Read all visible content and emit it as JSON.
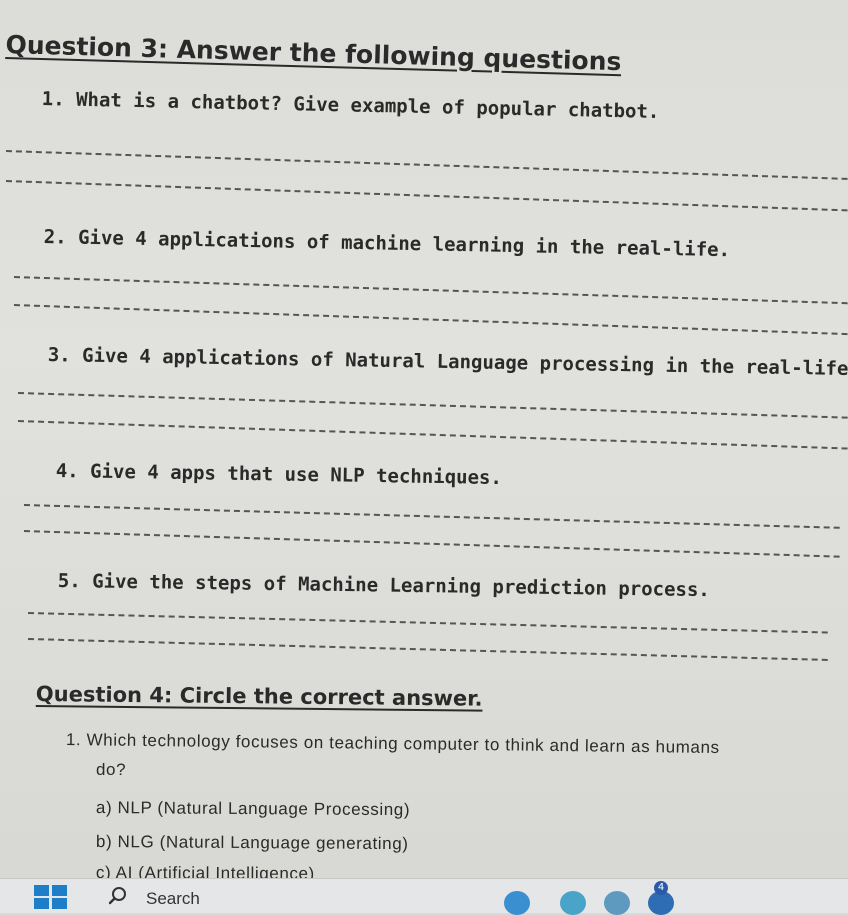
{
  "q3": {
    "title": "Question 3: Answer the following questions",
    "items": [
      "1. What is a chatbot? Give example of popular chatbot.",
      "2. Give 4 applications of machine learning in the real-life.",
      "3. Give 4 applications of Natural Language processing in the real-life.",
      "4. Give 4 apps that use NLP techniques.",
      "5. Give the steps of Machine Learning prediction process."
    ]
  },
  "q4": {
    "title": "Question 4: Circle the correct answer.",
    "question_line1": "1. Which technology focuses on teaching computer to think and learn as humans",
    "question_line2": "do?",
    "options": [
      "a) NLP (Natural Language Processing)",
      "b) NLG (Natural Language generating)",
      "c) AI (Artificial Intelligence)"
    ]
  },
  "taskbar": {
    "search_label": "Search",
    "notification_count": "4",
    "icons": [
      "windows-start-icon",
      "search-icon"
    ]
  },
  "colors": {
    "paper": "#dcdcd8",
    "ink": "#2a2a2a",
    "taskbar": "#e4e6e8",
    "start_blue": "#1e7ec8"
  }
}
